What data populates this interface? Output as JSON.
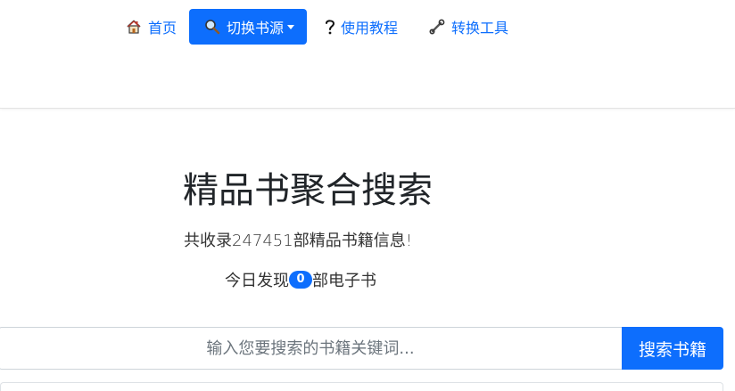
{
  "nav": {
    "home": {
      "label": "首页",
      "icon": "house-icon"
    },
    "switch_source": {
      "label": "切换书源",
      "icon": "magnifier-icon"
    },
    "tutorial": {
      "label": "使用教程",
      "icon": "question-icon"
    },
    "tools": {
      "label": "转换工具",
      "icon": "wrench-icon"
    }
  },
  "hero": {
    "title": "精品书聚合搜索",
    "subtitle": "共收录247451部精品书籍信息!",
    "today_prefix": "今日发现",
    "today_count": "0",
    "today_suffix": "部电子书"
  },
  "search": {
    "placeholder": "输入您要搜索的书籍关键词...",
    "value": "",
    "button_label": "搜索书籍"
  },
  "colors": {
    "primary": "#0d6efd",
    "text": "#212529"
  }
}
